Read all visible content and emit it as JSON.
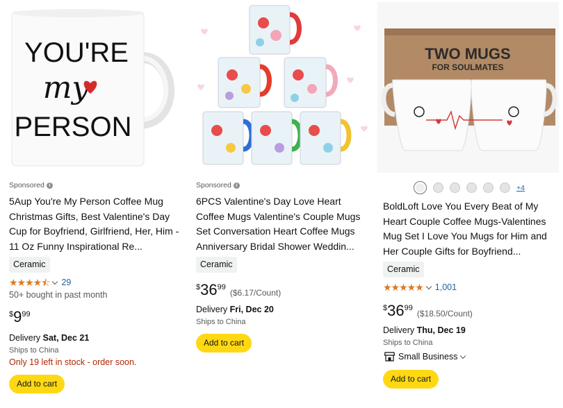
{
  "products": [
    {
      "sponsored": "Sponsored",
      "title": "5Aup You're My Person Coffee Mug Christmas Gifts, Best Valentine's Day Cup for Boyfriend, Girlfriend, Her, Him - 11 Oz Funny Inspirational Re...",
      "image_text": {
        "line1": "YOU'RE",
        "line2": "my",
        "line3": "PERSON"
      },
      "badge": "Ceramic",
      "rating": 4.5,
      "stars": "★★★★⯪",
      "review_count": "29",
      "bought": "50+ bought in past month",
      "price_symbol": "$",
      "price_whole": "9",
      "price_fraction": "99",
      "delivery_label": "Delivery ",
      "delivery_date": "Sat, Dec 21",
      "ships": "Ships to China",
      "stock": "Only 19 left in stock - order soon.",
      "cart": "Add to cart"
    },
    {
      "sponsored": "Sponsored",
      "title": "6PCS Valentine's Day Love Heart Coffee Mugs Valentine's Couple Mugs Set Conversation Heart Coffee Mugs Anniversary Bridal Shower Weddin...",
      "badge": "Ceramic",
      "price_symbol": "$",
      "price_whole": "36",
      "price_fraction": "99",
      "unit_price": "($6.17/Count)",
      "delivery_label": "Delivery ",
      "delivery_date": "Fri, Dec 20",
      "ships": "Ships to China",
      "cart": "Add to cart"
    },
    {
      "more_swatches": "+4",
      "title": "BoldLoft Love You Every Beat of My Heart Couple Coffee Mugs-Valentines Mug Set I Love You Mugs for Him and Her Couple Gifts for Boyfriend...",
      "image_text": {
        "line1": "TWO MUGS",
        "line2": "FOR SOULMATES"
      },
      "badge": "Ceramic",
      "rating": 5,
      "stars": "★★★★★",
      "review_count": "1,001",
      "price_symbol": "$",
      "price_whole": "36",
      "price_fraction": "99",
      "unit_price": "($18.50/Count)",
      "delivery_label": "Delivery ",
      "delivery_date": "Thu, Dec 19",
      "ships": "Ships to China",
      "small_business": "Small Business",
      "cart": "Add to cart"
    }
  ],
  "colors": {
    "cart_button": "#ffd814",
    "star": "#de7921",
    "link": "#2162a1",
    "stock_warning": "#b12704",
    "badge_bg": "#f0f2f2"
  }
}
